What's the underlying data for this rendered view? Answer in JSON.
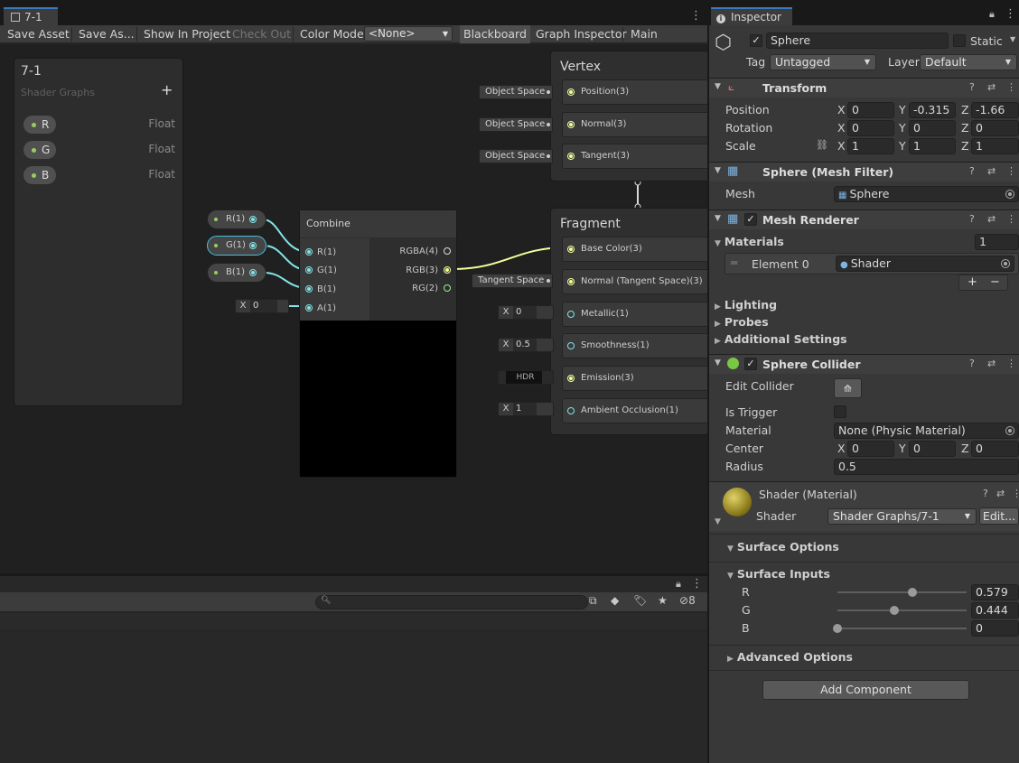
{
  "shader_graph": {
    "tab_title": "7-1",
    "toolbar": {
      "save_asset": "Save Asset",
      "save_as": "Save As...",
      "show_in_project": "Show In Project",
      "check_out": "Check Out",
      "color_mode_label": "Color Mode",
      "color_mode_value": "<None>",
      "blackboard": "Blackboard",
      "graph_inspector": "Graph Inspector",
      "main_preview": "Main Preview"
    },
    "blackboard": {
      "title": "7-1",
      "subtitle": "Shader Graphs",
      "add_symbol": "+",
      "properties": [
        {
          "name": "R",
          "type": "Float"
        },
        {
          "name": "G",
          "type": "Float"
        },
        {
          "name": "B",
          "type": "Float"
        }
      ]
    },
    "property_nodes": [
      "R(1)",
      "G(1)",
      "B(1)"
    ],
    "combine_node": {
      "title": "Combine",
      "inputs": [
        "R(1)",
        "G(1)",
        "B(1)",
        "A(1)"
      ],
      "outputs": [
        "RGBA(4)",
        "RGB(3)",
        "RG(2)"
      ],
      "a_field_label": "X",
      "a_field_value": "0"
    },
    "vertex": {
      "title": "Vertex",
      "slots": [
        {
          "label": "Position(3)",
          "space": "Object Space"
        },
        {
          "label": "Normal(3)",
          "space": "Object Space"
        },
        {
          "label": "Tangent(3)",
          "space": "Object Space"
        }
      ]
    },
    "fragment": {
      "title": "Fragment",
      "slots": [
        {
          "label": "Base Color(3)",
          "input": ""
        },
        {
          "label": "Normal (Tangent Space)(3)",
          "input": "Tangent Space"
        },
        {
          "label": "Metallic(1)",
          "input_label": "X",
          "input": "0"
        },
        {
          "label": "Smoothness(1)",
          "input_label": "X",
          "input": "0.5"
        },
        {
          "label": "Emission(3)",
          "input": "HDR"
        },
        {
          "label": "Ambient Occlusion(1)",
          "input_label": "X",
          "input": "1"
        }
      ]
    }
  },
  "bottom_panel": {
    "hidden_count": "8"
  },
  "inspector": {
    "tab_title": "Inspector",
    "object_name": "Sphere",
    "static_label": "Static",
    "tag_label": "Tag",
    "tag_value": "Untagged",
    "layer_label": "Layer",
    "layer_value": "Default",
    "transform": {
      "title": "Transform",
      "position_label": "Position",
      "rotation_label": "Rotation",
      "scale_label": "Scale",
      "axis_x": "X",
      "axis_y": "Y",
      "axis_z": "Z",
      "position": [
        "0",
        "-0.315",
        "-1.66"
      ],
      "rotation": [
        "0",
        "0",
        "0"
      ],
      "scale": [
        "1",
        "1",
        "1"
      ]
    },
    "mesh_filter": {
      "title": "Sphere (Mesh Filter)",
      "mesh_label": "Mesh",
      "mesh_value": "Sphere"
    },
    "mesh_renderer": {
      "title": "Mesh Renderer",
      "materials_label": "Materials",
      "materials_count": "1",
      "element_label": "Element 0",
      "element_value": "Shader",
      "add_symbol": "+",
      "remove_symbol": "−",
      "lighting": "Lighting",
      "probes": "Probes",
      "additional_settings": "Additional Settings"
    },
    "sphere_collider": {
      "title": "Sphere Collider",
      "edit_collider_label": "Edit Collider",
      "is_trigger_label": "Is Trigger",
      "material_label": "Material",
      "material_value": "None (Physic Material)",
      "center_label": "Center",
      "center": [
        "0",
        "0",
        "0"
      ],
      "radius_label": "Radius",
      "radius_value": "0.5"
    },
    "material": {
      "title": "Shader (Material)",
      "shader_label": "Shader",
      "shader_value": "Shader Graphs/7-1",
      "edit_button": "Edit...",
      "surface_options": "Surface Options",
      "surface_inputs": "Surface Inputs",
      "inputs": [
        {
          "label": "R",
          "value": "0.579",
          "fraction": 0.579
        },
        {
          "label": "G",
          "value": "0.444",
          "fraction": 0.444
        },
        {
          "label": "B",
          "value": "0",
          "fraction": 0
        }
      ],
      "advanced_options": "Advanced Options"
    },
    "add_component": "Add Component"
  }
}
